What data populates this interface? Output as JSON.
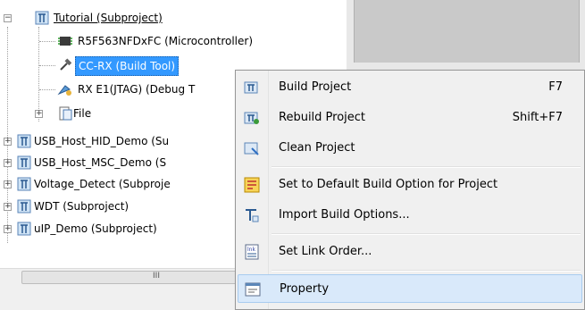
{
  "tree": {
    "items": [
      {
        "label": "Tutorial (Subproject)"
      },
      {
        "label": "R5F563NFDxFC (Microcontroller)"
      },
      {
        "label": "CC-RX (Build Tool)"
      },
      {
        "label": "RX E1(JTAG) (Debug T"
      },
      {
        "label": "File"
      },
      {
        "label": "USB_Host_HID_Demo (Su"
      },
      {
        "label": "USB_Host_MSC_Demo (S"
      },
      {
        "label": "Voltage_Detect (Subproje"
      },
      {
        "label": "WDT (Subproject)"
      },
      {
        "label": "uIP_Demo (Subproject)"
      }
    ],
    "expand_symbols": {
      "minus": "−",
      "plus": "+"
    },
    "scroll_grip": "III"
  },
  "context_menu": {
    "items": [
      {
        "label": "Build Project",
        "shortcut": "F7",
        "icon": "build-project-icon"
      },
      {
        "label": "Rebuild Project",
        "shortcut": "Shift+F7",
        "icon": "rebuild-project-icon"
      },
      {
        "label": "Clean Project",
        "shortcut": "",
        "icon": "clean-project-icon"
      },
      {
        "label": "Set to Default Build Option for Project",
        "shortcut": "",
        "icon": "default-build-option-icon"
      },
      {
        "label": "Import Build Options...",
        "shortcut": "",
        "icon": "import-build-options-icon"
      },
      {
        "label": "Set Link Order...",
        "shortcut": "",
        "icon": "link-order-icon"
      },
      {
        "label": "Property",
        "shortcut": "",
        "icon": "property-icon",
        "highlighted": true
      }
    ]
  },
  "colors": {
    "selection": "#3399ff",
    "menu_highlight": "#d9e9fa",
    "menu_bg": "#f0f0f0"
  }
}
